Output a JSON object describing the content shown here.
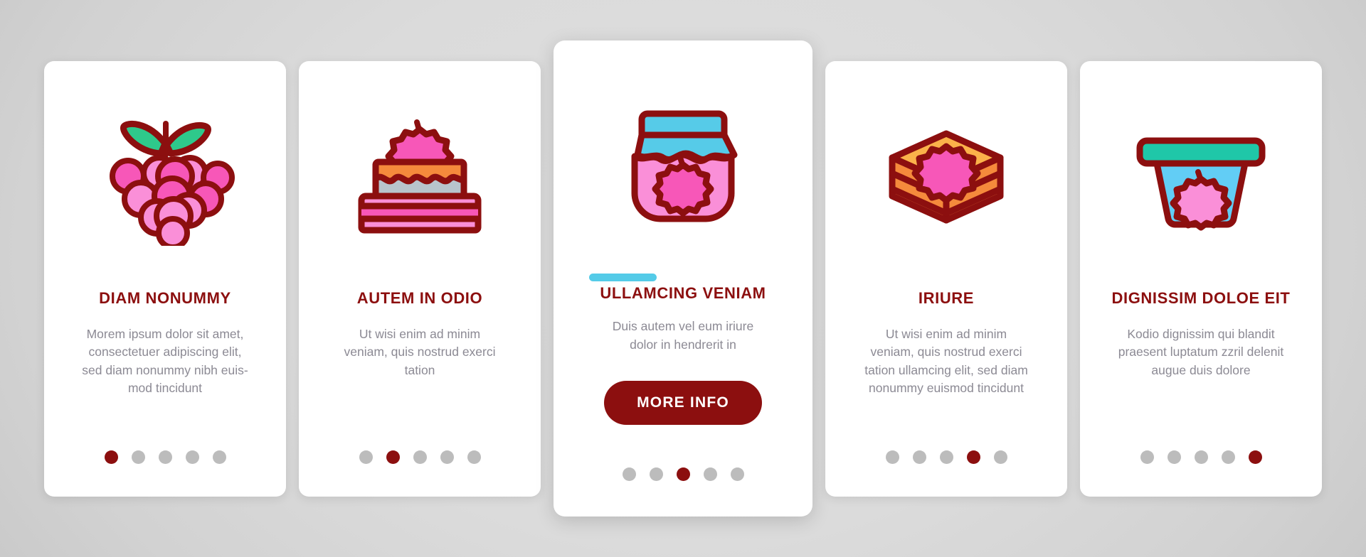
{
  "theme": {
    "outline": "#8c0f0f",
    "accent_cyan": "#54cbe8",
    "title_color": "#8c0f0f",
    "body_color": "#8c8a94",
    "dot_inactive": "#bcbcbc",
    "dot_active": "#8c0f0f",
    "card_bg": "#ffffff",
    "page_bg": "#d6d6d6",
    "pink_light": "#fa8fd8",
    "pink_mid": "#f757b8",
    "orange": "#f58a3c",
    "orange_light": "#fbb24a",
    "cyan": "#56cbe8",
    "teal": "#1fc7a8",
    "green": "#2ec98b",
    "gray_blue": "#b8c4cc"
  },
  "cards": [
    {
      "id": "card-diam-nonummy",
      "icon": "raspberry-bunch-icon",
      "title": "DIAM NONUMMY",
      "body": "Morem ipsum dolor sit amet,\nconsectetuer adipiscing elit,\nsed diam nonummy nibh euis-\nmod tincidunt",
      "featured": false,
      "accent_bar": false,
      "cta": null,
      "dots": 5,
      "active_dot": 0
    },
    {
      "id": "card-autem-in-odio",
      "icon": "layer-cake-icon",
      "title": "AUTEM IN ODIO",
      "body": "Ut wisi enim ad minim\nveniam, quis nostrud exerci\ntation",
      "featured": false,
      "accent_bar": false,
      "cta": null,
      "dots": 5,
      "active_dot": 1
    },
    {
      "id": "card-ullamcing-veniam",
      "icon": "jam-jar-icon",
      "title": "ULLAMCING VENIAM",
      "body": "Duis autem vel eum iriure\ndolor in hendrerit in",
      "featured": true,
      "accent_bar": true,
      "cta": "MORE INFO",
      "dots": 5,
      "active_dot": 2
    },
    {
      "id": "card-iriure",
      "icon": "cake-slice-icon",
      "title": "IRIURE",
      "body": "Ut wisi enim ad minim\nveniam, quis nostrud exerci\ntation ullamcing elit, sed diam\nnonummy euismod tincidunt",
      "featured": false,
      "accent_bar": false,
      "cta": null,
      "dots": 5,
      "active_dot": 3
    },
    {
      "id": "card-dignissim-doloe-eit",
      "icon": "yogurt-cup-icon",
      "title": "DIGNISSIM DOLOE EIT",
      "body": "Kodio dignissim qui blandit\npraesent luptatum zzril delenit\naugue duis dolore",
      "featured": false,
      "accent_bar": false,
      "cta": null,
      "dots": 5,
      "active_dot": 4
    }
  ]
}
